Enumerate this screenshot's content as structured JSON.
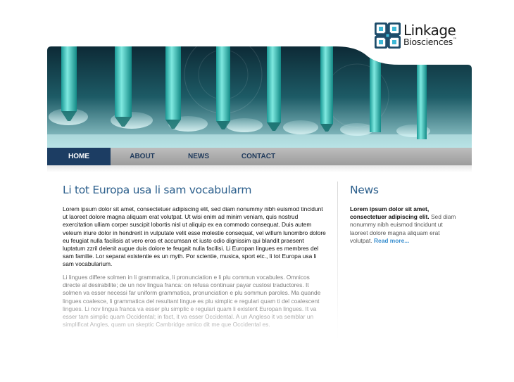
{
  "logo": {
    "line1": "Linkage",
    "line2": "Biosciences",
    "trademark": "™",
    "icon": "linked-squares-icon",
    "colors": {
      "mark": "#1e4d6b",
      "accent": "#3db8d6"
    }
  },
  "nav": {
    "items": [
      {
        "label": "HOME",
        "active": true
      },
      {
        "label": "ABOUT",
        "active": false
      },
      {
        "label": "NEWS",
        "active": false
      },
      {
        "label": "CONTACT",
        "active": false
      }
    ],
    "colors": {
      "active_bg": "#1c3d63",
      "text": "#1f3a5c"
    }
  },
  "hero": {
    "image": "laboratory-pipettes-photo",
    "colors": {
      "tint": "#2aa7a7"
    }
  },
  "main": {
    "title": "Li tot Europa usa li sam vocabularm",
    "paragraph1": "Lorem ipsum dolor sit amet, consectetuer adipiscing elit, sed diam nonummy nibh euismod tincidunt ut laoreet dolore magna aliquam erat volutpat. Ut wisi enim ad minim veniam, quis nostrud exercitation ulliam corper suscipit lobortis nisl ut aliquip ex ea commodo consequat. Duis autem veleum iriure dolor in hendrerit in vulputate velit esse molestie consequat, vel willum lunombro dolore eu feugiat nulla facilisis at vero eros et accumsan et iusto odio dignissim qui blandit praesent luptatum zzril delenit augue duis dolore te feugait nulla facilisi. Li Europan lingues es membres del sam familie. Lor separat existentie es un myth. Por scientie, musica, sport etc., li tot Europa usa li sam vocabularium.",
    "paragraph2": "Li lingues differe solmen in li grammatica, li pronunciation e li plu commun vocabules. Omnicos directe al desirabilite; de un nov lingua franca: on refusa continuar payar custosi traductores. It solmen va esser necessi far uniform grammatica, pronunciation e plu sommun paroles. Ma quande lingues coalesce, li grammatica del resultant lingue es plu simplic e regulari quam ti del coalescent lingues. Li nov lingua franca va esser plu simplic e regulari quam li existent Europan lingues. It va esser tam simplic quam Occidental; in fact, it va esser Occidental. A un Angleso it va semblar un simplificat Angles, quam un skeptic Cambridge amico dit me que Occidental es."
  },
  "sidebar": {
    "title": "News",
    "lead": "Lorem ipsum dolor sit amet, consectetuer adipiscing elit.",
    "body": " Sed diam nonummy nibh euismod tincidunt ut laoreet dolore magna aliquam erat volutpat.",
    "read_more": "Read more..."
  }
}
